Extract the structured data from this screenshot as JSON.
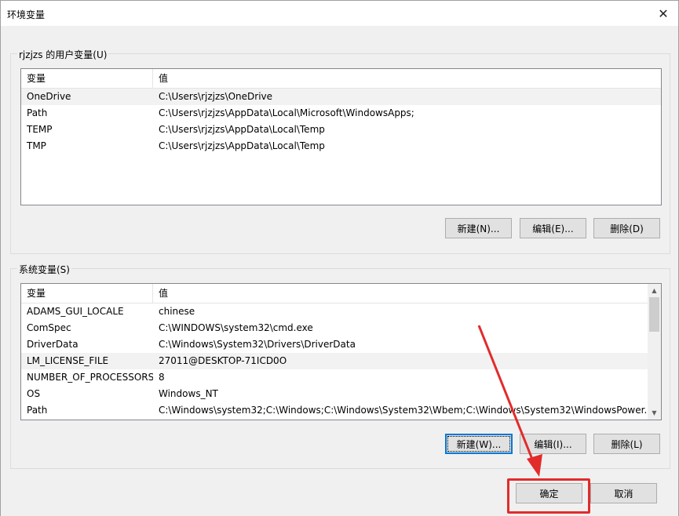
{
  "window": {
    "title": "环境变量",
    "close_glyph": "✕"
  },
  "user_vars": {
    "legend": "rjzjzs 的用户变量(U)",
    "col_name": "变量",
    "col_value": "值",
    "rows": [
      {
        "name": "OneDrive",
        "value": "C:\\Users\\rjzjzs\\OneDrive"
      },
      {
        "name": "Path",
        "value": "C:\\Users\\rjzjzs\\AppData\\Local\\Microsoft\\WindowsApps;"
      },
      {
        "name": "TEMP",
        "value": "C:\\Users\\rjzjzs\\AppData\\Local\\Temp"
      },
      {
        "name": "TMP",
        "value": "C:\\Users\\rjzjzs\\AppData\\Local\\Temp"
      }
    ],
    "new_label": "新建(N)...",
    "edit_label": "编辑(E)...",
    "delete_label": "删除(D)"
  },
  "system_vars": {
    "legend": "系统变量(S)",
    "col_name": "变量",
    "col_value": "值",
    "rows": [
      {
        "name": "ADAMS_GUI_LOCALE",
        "value": "chinese"
      },
      {
        "name": "ComSpec",
        "value": "C:\\WINDOWS\\system32\\cmd.exe"
      },
      {
        "name": "DriverData",
        "value": "C:\\Windows\\System32\\Drivers\\DriverData"
      },
      {
        "name": "LM_LICENSE_FILE",
        "value": "27011@DESKTOP-71ICD0O"
      },
      {
        "name": "NUMBER_OF_PROCESSORS",
        "value": "8"
      },
      {
        "name": "OS",
        "value": "Windows_NT"
      },
      {
        "name": "Path",
        "value": "C:\\Windows\\system32;C:\\Windows;C:\\Windows\\System32\\Wbem;C:\\Windows\\System32\\WindowsPower..."
      }
    ],
    "new_label": "新建(W)...",
    "edit_label": "编辑(I)...",
    "delete_label": "删除(L)"
  },
  "footer": {
    "ok_label": "确定",
    "cancel_label": "取消"
  },
  "annotation": {
    "arrow_color": "#e22b2b",
    "highlight_color": "#e22b2b"
  }
}
